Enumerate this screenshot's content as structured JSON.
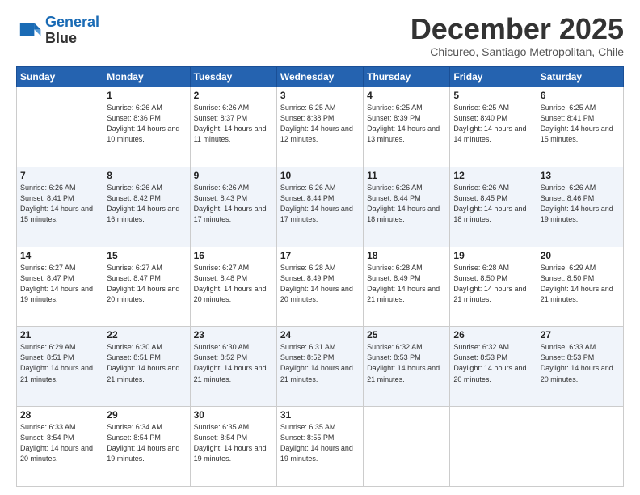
{
  "logo": {
    "line1": "General",
    "line2": "Blue"
  },
  "title": "December 2025",
  "location": "Chicureo, Santiago Metropolitan, Chile",
  "days_header": [
    "Sunday",
    "Monday",
    "Tuesday",
    "Wednesday",
    "Thursday",
    "Friday",
    "Saturday"
  ],
  "weeks": [
    [
      {
        "num": "",
        "sunrise": "",
        "sunset": "",
        "daylight": ""
      },
      {
        "num": "1",
        "sunrise": "Sunrise: 6:26 AM",
        "sunset": "Sunset: 8:36 PM",
        "daylight": "Daylight: 14 hours and 10 minutes."
      },
      {
        "num": "2",
        "sunrise": "Sunrise: 6:26 AM",
        "sunset": "Sunset: 8:37 PM",
        "daylight": "Daylight: 14 hours and 11 minutes."
      },
      {
        "num": "3",
        "sunrise": "Sunrise: 6:25 AM",
        "sunset": "Sunset: 8:38 PM",
        "daylight": "Daylight: 14 hours and 12 minutes."
      },
      {
        "num": "4",
        "sunrise": "Sunrise: 6:25 AM",
        "sunset": "Sunset: 8:39 PM",
        "daylight": "Daylight: 14 hours and 13 minutes."
      },
      {
        "num": "5",
        "sunrise": "Sunrise: 6:25 AM",
        "sunset": "Sunset: 8:40 PM",
        "daylight": "Daylight: 14 hours and 14 minutes."
      },
      {
        "num": "6",
        "sunrise": "Sunrise: 6:25 AM",
        "sunset": "Sunset: 8:41 PM",
        "daylight": "Daylight: 14 hours and 15 minutes."
      }
    ],
    [
      {
        "num": "7",
        "sunrise": "Sunrise: 6:26 AM",
        "sunset": "Sunset: 8:41 PM",
        "daylight": "Daylight: 14 hours and 15 minutes."
      },
      {
        "num": "8",
        "sunrise": "Sunrise: 6:26 AM",
        "sunset": "Sunset: 8:42 PM",
        "daylight": "Daylight: 14 hours and 16 minutes."
      },
      {
        "num": "9",
        "sunrise": "Sunrise: 6:26 AM",
        "sunset": "Sunset: 8:43 PM",
        "daylight": "Daylight: 14 hours and 17 minutes."
      },
      {
        "num": "10",
        "sunrise": "Sunrise: 6:26 AM",
        "sunset": "Sunset: 8:44 PM",
        "daylight": "Daylight: 14 hours and 17 minutes."
      },
      {
        "num": "11",
        "sunrise": "Sunrise: 6:26 AM",
        "sunset": "Sunset: 8:44 PM",
        "daylight": "Daylight: 14 hours and 18 minutes."
      },
      {
        "num": "12",
        "sunrise": "Sunrise: 6:26 AM",
        "sunset": "Sunset: 8:45 PM",
        "daylight": "Daylight: 14 hours and 18 minutes."
      },
      {
        "num": "13",
        "sunrise": "Sunrise: 6:26 AM",
        "sunset": "Sunset: 8:46 PM",
        "daylight": "Daylight: 14 hours and 19 minutes."
      }
    ],
    [
      {
        "num": "14",
        "sunrise": "Sunrise: 6:27 AM",
        "sunset": "Sunset: 8:47 PM",
        "daylight": "Daylight: 14 hours and 19 minutes."
      },
      {
        "num": "15",
        "sunrise": "Sunrise: 6:27 AM",
        "sunset": "Sunset: 8:47 PM",
        "daylight": "Daylight: 14 hours and 20 minutes."
      },
      {
        "num": "16",
        "sunrise": "Sunrise: 6:27 AM",
        "sunset": "Sunset: 8:48 PM",
        "daylight": "Daylight: 14 hours and 20 minutes."
      },
      {
        "num": "17",
        "sunrise": "Sunrise: 6:28 AM",
        "sunset": "Sunset: 8:49 PM",
        "daylight": "Daylight: 14 hours and 20 minutes."
      },
      {
        "num": "18",
        "sunrise": "Sunrise: 6:28 AM",
        "sunset": "Sunset: 8:49 PM",
        "daylight": "Daylight: 14 hours and 21 minutes."
      },
      {
        "num": "19",
        "sunrise": "Sunrise: 6:28 AM",
        "sunset": "Sunset: 8:50 PM",
        "daylight": "Daylight: 14 hours and 21 minutes."
      },
      {
        "num": "20",
        "sunrise": "Sunrise: 6:29 AM",
        "sunset": "Sunset: 8:50 PM",
        "daylight": "Daylight: 14 hours and 21 minutes."
      }
    ],
    [
      {
        "num": "21",
        "sunrise": "Sunrise: 6:29 AM",
        "sunset": "Sunset: 8:51 PM",
        "daylight": "Daylight: 14 hours and 21 minutes."
      },
      {
        "num": "22",
        "sunrise": "Sunrise: 6:30 AM",
        "sunset": "Sunset: 8:51 PM",
        "daylight": "Daylight: 14 hours and 21 minutes."
      },
      {
        "num": "23",
        "sunrise": "Sunrise: 6:30 AM",
        "sunset": "Sunset: 8:52 PM",
        "daylight": "Daylight: 14 hours and 21 minutes."
      },
      {
        "num": "24",
        "sunrise": "Sunrise: 6:31 AM",
        "sunset": "Sunset: 8:52 PM",
        "daylight": "Daylight: 14 hours and 21 minutes."
      },
      {
        "num": "25",
        "sunrise": "Sunrise: 6:32 AM",
        "sunset": "Sunset: 8:53 PM",
        "daylight": "Daylight: 14 hours and 21 minutes."
      },
      {
        "num": "26",
        "sunrise": "Sunrise: 6:32 AM",
        "sunset": "Sunset: 8:53 PM",
        "daylight": "Daylight: 14 hours and 20 minutes."
      },
      {
        "num": "27",
        "sunrise": "Sunrise: 6:33 AM",
        "sunset": "Sunset: 8:53 PM",
        "daylight": "Daylight: 14 hours and 20 minutes."
      }
    ],
    [
      {
        "num": "28",
        "sunrise": "Sunrise: 6:33 AM",
        "sunset": "Sunset: 8:54 PM",
        "daylight": "Daylight: 14 hours and 20 minutes."
      },
      {
        "num": "29",
        "sunrise": "Sunrise: 6:34 AM",
        "sunset": "Sunset: 8:54 PM",
        "daylight": "Daylight: 14 hours and 19 minutes."
      },
      {
        "num": "30",
        "sunrise": "Sunrise: 6:35 AM",
        "sunset": "Sunset: 8:54 PM",
        "daylight": "Daylight: 14 hours and 19 minutes."
      },
      {
        "num": "31",
        "sunrise": "Sunrise: 6:35 AM",
        "sunset": "Sunset: 8:55 PM",
        "daylight": "Daylight: 14 hours and 19 minutes."
      },
      {
        "num": "",
        "sunrise": "",
        "sunset": "",
        "daylight": ""
      },
      {
        "num": "",
        "sunrise": "",
        "sunset": "",
        "daylight": ""
      },
      {
        "num": "",
        "sunrise": "",
        "sunset": "",
        "daylight": ""
      }
    ]
  ]
}
